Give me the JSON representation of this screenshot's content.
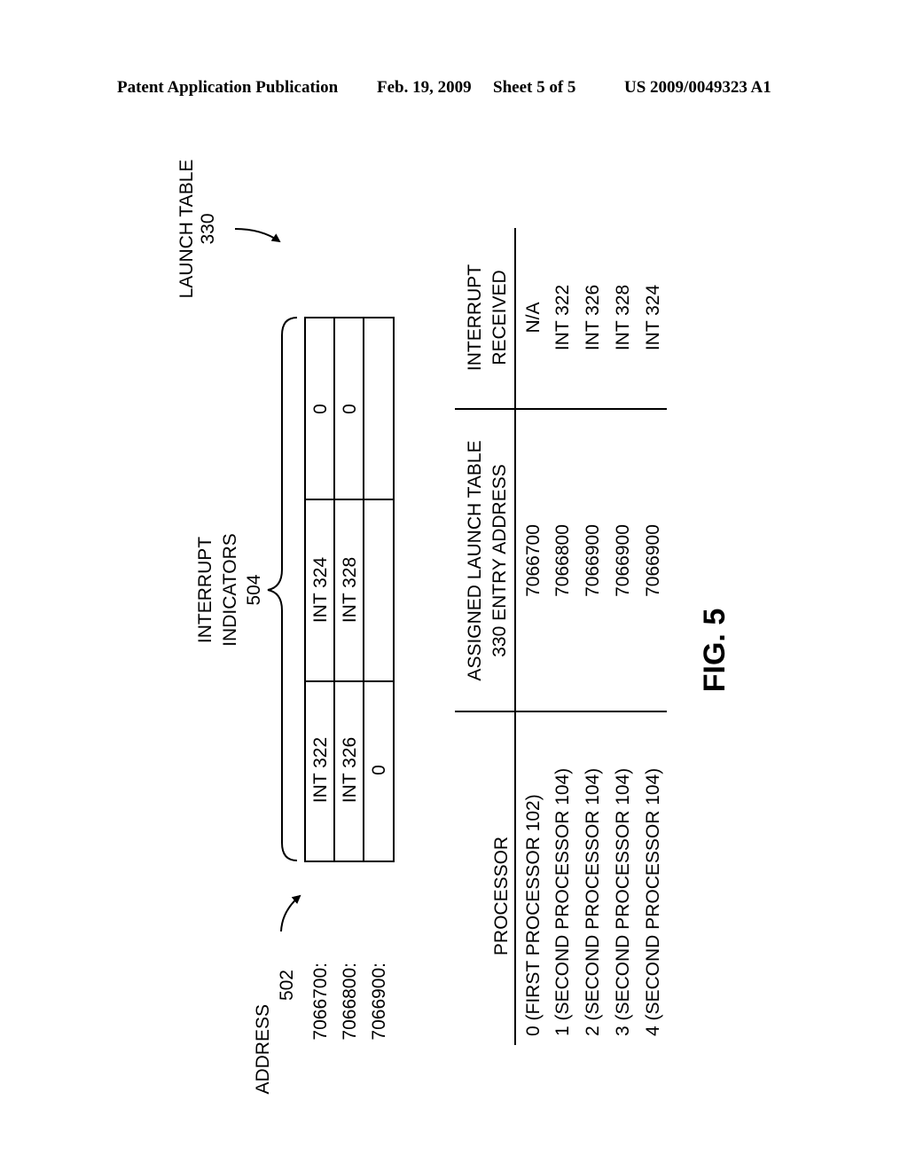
{
  "header": {
    "publication": "Patent Application Publication",
    "date": "Feb. 19, 2009",
    "sheet": "Sheet 5 of 5",
    "patent_number": "US 2009/0049323 A1"
  },
  "launch_table": {
    "label_line1": "LAUNCH TABLE",
    "label_line2": "330"
  },
  "address_label": {
    "line1": "ADDRESS",
    "line2": "502"
  },
  "indicators_label": {
    "line1": "INTERRUPT",
    "line2": "INDICATORS",
    "line3": "504"
  },
  "memory_rows": [
    {
      "address": "7066700:",
      "cells": [
        "INT 322",
        "INT 324",
        "0"
      ]
    },
    {
      "address": "7066800:",
      "cells": [
        "INT 326",
        "INT 328",
        "0"
      ]
    },
    {
      "address": "7066900:",
      "cells": [
        "0",
        "",
        ""
      ]
    }
  ],
  "assignment_table": {
    "headers": {
      "processor": "PROCESSOR",
      "address_line1": "ASSIGNED LAUNCH TABLE",
      "address_line2": "330 ENTRY ADDRESS",
      "interrupt_line1": "INTERRUPT",
      "interrupt_line2": "RECEIVED"
    },
    "rows": [
      {
        "processor": "0 (FIRST PROCESSOR 102)",
        "address": "7066700",
        "interrupt": "N/A"
      },
      {
        "processor": "1 (SECOND PROCESSOR 104)",
        "address": "7066800",
        "interrupt": "INT 322"
      },
      {
        "processor": "2 (SECOND PROCESSOR 104)",
        "address": "7066900",
        "interrupt": "INT 326"
      },
      {
        "processor": "3 (SECOND PROCESSOR 104)",
        "address": "7066900",
        "interrupt": "INT 328"
      },
      {
        "processor": "4 (SECOND PROCESSOR 104)",
        "address": "7066900",
        "interrupt": "INT 324"
      }
    ]
  },
  "figure_label": "FIG. 5"
}
